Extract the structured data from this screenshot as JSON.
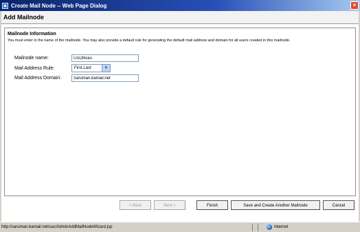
{
  "window": {
    "title": "Create Mail Node -- Web Page Dialog",
    "close_glyph": "×"
  },
  "page": {
    "header": "Add Mailnode"
  },
  "section": {
    "title": "Mailnode Information",
    "instructions": "You must enter in the name of the mailnode. You may also provide a default rule for generating the default mail address and domain for all users created in this mailnode."
  },
  "form": {
    "mailnode_name_label": "Mailnode name:",
    "mailnode_name_value": "USOffices",
    "mail_address_rule_label": "Mail Address Rule:",
    "mail_address_rule_value": "First.Last",
    "mail_address_domain_label": "Mail Address Domain:",
    "mail_address_domain_value": "Saruman.bamail.net"
  },
  "buttons": {
    "back": "< Back",
    "next": "Next >",
    "finish": "Finish",
    "save_and_create": "Save and Create Another Mailnode",
    "cancel": "Cancel"
  },
  "statusbar": {
    "url": "http://saruman.bamail.net/sac/AdminAddMailNodeWizard.jsp",
    "zone": "Internet"
  },
  "icons": {
    "title_icon": "ie-page-icon",
    "dropdown": "chevron-down-icon",
    "zone": "globe-icon"
  }
}
